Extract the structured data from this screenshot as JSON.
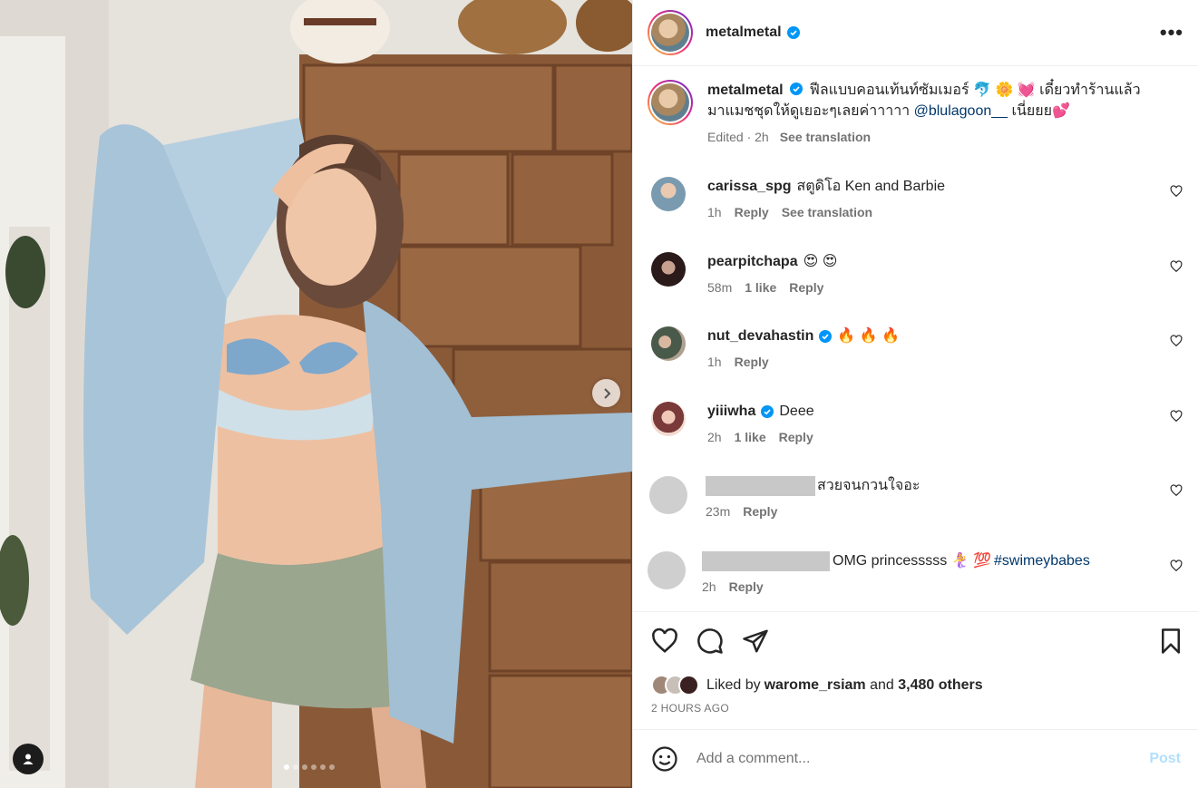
{
  "post": {
    "username": "metalmetal",
    "more_label": "•••",
    "slide_count": 6,
    "active_slide": 1
  },
  "caption": {
    "username": "metalmetal",
    "text_part1": "ฟีลแบบคอนเท้นท์ซัมเมอร์ 🐬 🌼 💓 เดี๋ยวทำร้านแล้วมาแมชชุดให้ดูเยอะๆเลยค่าาาาา ",
    "mention": "@blulagoon__",
    "text_part2": " เนี่ยยย💕",
    "edited": "Edited · 2h",
    "see_translation": "See translation"
  },
  "comments": [
    {
      "username": "carissa_spg",
      "verified": false,
      "text": "สตูดิโอ Ken and Barbie",
      "time": "1h",
      "likes": "",
      "reply": "Reply",
      "translation": "See translation"
    },
    {
      "username": "pearpitchapa",
      "verified": false,
      "text": "😍 😍",
      "time": "58m",
      "likes": "1 like",
      "reply": "Reply",
      "translation": ""
    },
    {
      "username": "nut_devahastin",
      "verified": true,
      "text": "🔥 🔥 🔥",
      "time": "1h",
      "likes": "",
      "reply": "Reply",
      "translation": ""
    },
    {
      "username": "yiiiwha",
      "verified": true,
      "text": "Deee",
      "time": "2h",
      "likes": "1 like",
      "reply": "Reply",
      "translation": ""
    },
    {
      "username": "",
      "verified": false,
      "text": "สวยจนกวนใจอะ",
      "time": "23m",
      "likes": "",
      "reply": "Reply",
      "translation": ""
    },
    {
      "username": "",
      "verified": false,
      "text": "OMG princesssss 🧜‍♀️ 💯 ",
      "hashtag": "#swimeybabes",
      "time": "2h",
      "likes": "",
      "reply": "Reply",
      "translation": ""
    }
  ],
  "likes": {
    "prefix": "Liked by ",
    "user": "warome_rsiam",
    "middle": " and ",
    "count": "3,480 others"
  },
  "time_ago": "2 HOURS AGO",
  "add_comment": {
    "placeholder": "Add a comment...",
    "post_label": "Post"
  },
  "colors": {
    "accent": "#0095f6",
    "post_disabled": "#b2dffc",
    "link": "#00376b",
    "meta": "#737373",
    "verified": "#0095f6"
  }
}
